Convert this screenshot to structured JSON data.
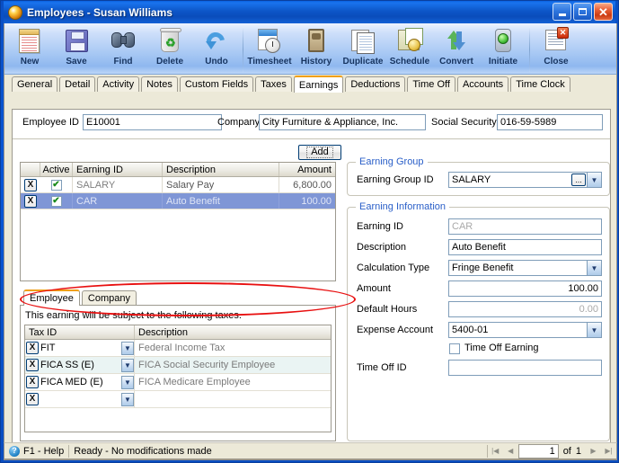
{
  "window": {
    "title": "Employees - Susan Williams",
    "icon": "app-icon",
    "minimize": "_",
    "maximize": "□",
    "close": "✕"
  },
  "toolbar": {
    "buttons": [
      {
        "label": "New",
        "icon": "new-document-icon"
      },
      {
        "label": "Save",
        "icon": "floppy-disk-icon"
      },
      {
        "label": "Find",
        "icon": "binoculars-icon"
      },
      {
        "label": "Delete",
        "icon": "trash-can-icon"
      },
      {
        "label": "Undo",
        "icon": "undo-arrow-icon"
      },
      {
        "label": "Timesheet",
        "icon": "timesheet-clock-icon"
      },
      {
        "label": "History",
        "icon": "hourglass-icon"
      },
      {
        "label": "Duplicate",
        "icon": "duplicate-pages-icon"
      },
      {
        "label": "Schedule",
        "icon": "schedule-calendar-icon"
      },
      {
        "label": "Convert",
        "icon": "convert-arrows-icon"
      },
      {
        "label": "Initiate",
        "icon": "traffic-light-icon"
      },
      {
        "label": "Close",
        "icon": "close-document-icon"
      }
    ]
  },
  "tabs": [
    {
      "label": "General",
      "active": false
    },
    {
      "label": "Detail",
      "active": false
    },
    {
      "label": "Activity",
      "active": false
    },
    {
      "label": "Notes",
      "active": false
    },
    {
      "label": "Custom Fields",
      "active": false
    },
    {
      "label": "Taxes",
      "active": false
    },
    {
      "label": "Earnings",
      "active": true
    },
    {
      "label": "Deductions",
      "active": false
    },
    {
      "label": "Time Off",
      "active": false
    },
    {
      "label": "Accounts",
      "active": false
    },
    {
      "label": "Time Clock",
      "active": false
    }
  ],
  "header_fields": {
    "employee_id_label": "Employee ID",
    "employee_id_value": "E10001",
    "company_label": "Company",
    "company_value": "City Furniture & Appliance, Inc.",
    "ssn_label": "Social Security",
    "ssn_value": "016-59-5989"
  },
  "add_button": "Add",
  "earnings_grid": {
    "columns": [
      "",
      "Active",
      "Earning ID",
      "Description",
      "Amount"
    ],
    "rows": [
      {
        "delete": "X",
        "active": "✔",
        "earning_id": "SALARY",
        "description": "Salary Pay",
        "amount": "6,800.00",
        "selected": false
      },
      {
        "delete": "X",
        "active": "✔",
        "earning_id": "CAR",
        "description": "Auto Benefit",
        "amount": "100.00",
        "selected": true
      }
    ]
  },
  "tax_panel": {
    "tabs": [
      {
        "label": "Employee",
        "active": true
      },
      {
        "label": "Company",
        "active": false
      }
    ],
    "note": "This earning will be subject to the following taxes.",
    "columns": [
      "Tax ID",
      "Description"
    ],
    "rows": [
      {
        "delete": "X",
        "tax_id": "FIT",
        "description": "Federal Income Tax"
      },
      {
        "delete": "X",
        "tax_id": "FICA SS (E)",
        "description": "FICA Social Security Employee"
      },
      {
        "delete": "X",
        "tax_id": "FICA MED (E)",
        "description": "FICA Medicare Employee"
      },
      {
        "delete": "X",
        "tax_id": "",
        "description": ""
      }
    ]
  },
  "earning_group": {
    "title": "Earning Group",
    "id_label": "Earning Group ID",
    "id_value": "SALARY",
    "lookup_button": "...",
    "dropdown_arrow": "▼"
  },
  "earning_information": {
    "title": "Earning Information",
    "earning_id_label": "Earning ID",
    "earning_id_value": "CAR",
    "description_label": "Description",
    "description_value": "Auto Benefit",
    "calculation_type_label": "Calculation Type",
    "calculation_type_value": "Fringe Benefit",
    "amount_label": "Amount",
    "amount_value": "100.00",
    "default_hours_label": "Default Hours",
    "default_hours_value": "0.00",
    "expense_account_label": "Expense Account",
    "expense_account_value": "5400-01",
    "time_off_earning_label": "Time Off Earning",
    "time_off_earning_checked": false,
    "time_off_id_label": "Time Off ID",
    "time_off_id_value": ""
  },
  "status_bar": {
    "help": "F1 - Help",
    "message": "Ready - No modifications made",
    "first": "|◀",
    "prev": "◀",
    "page": "1",
    "of": "of",
    "total": "1",
    "next": "▶",
    "last": "▶|"
  },
  "annotation": {
    "shape": "red-ellipse-highlight",
    "target": "CAR / Auto Benefit earnings row"
  },
  "colors": {
    "titlebar_blue": "#0d56c8",
    "accent_orange": "#f0a017",
    "selection_blue": "#7f96d6",
    "group_title_blue": "#2a5fc8",
    "annotation_red": "#e81010"
  }
}
